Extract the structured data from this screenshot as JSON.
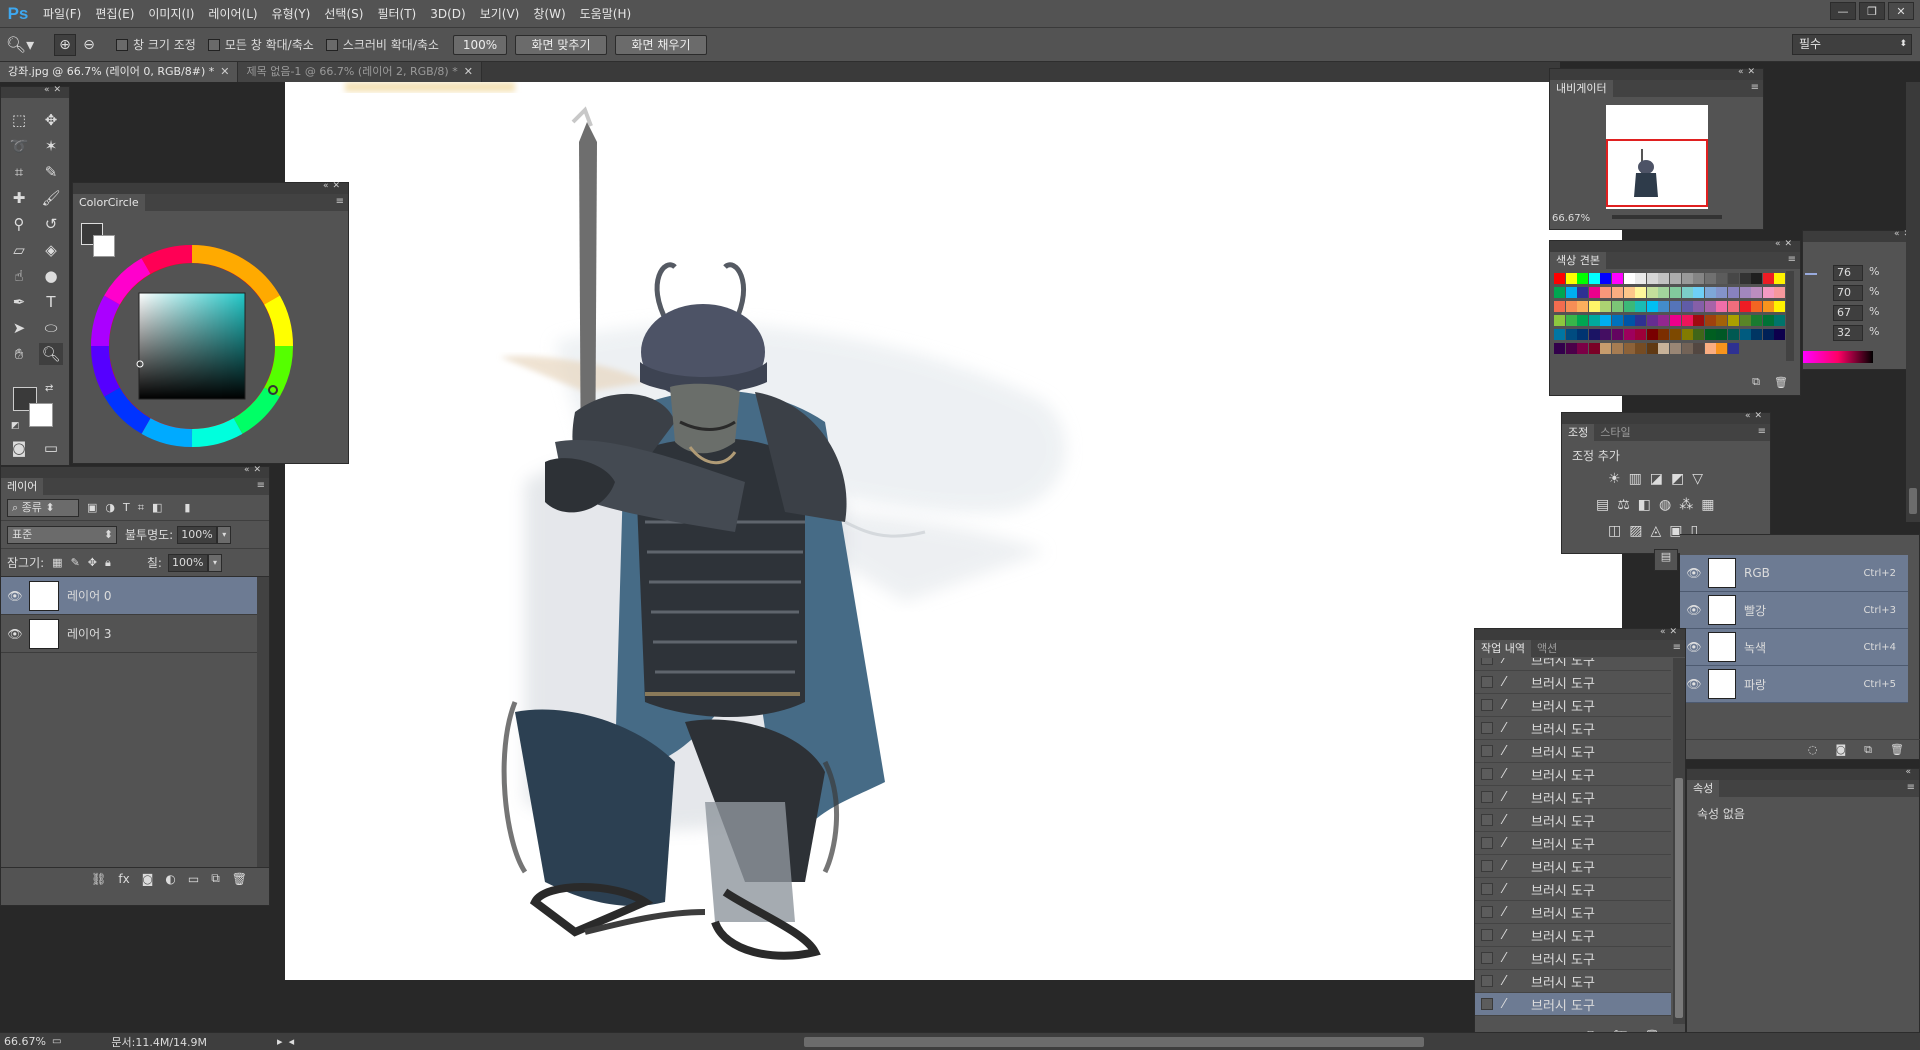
{
  "app": {
    "logo": "Ps"
  },
  "menu": [
    "파일(F)",
    "편집(E)",
    "이미지(I)",
    "레이어(L)",
    "유형(Y)",
    "선택(S)",
    "필터(T)",
    "3D(D)",
    "보기(V)",
    "창(W)",
    "도움말(H)"
  ],
  "window_controls": {
    "minimize": "—",
    "restore": "❐",
    "close": "✕"
  },
  "options": {
    "zoom_in": "⊕",
    "zoom_out": "⊖",
    "resize_window": "창 크기 조정",
    "zoom_all": "모든 창 확대/축소",
    "scrubby": "스크러비 확대/축소",
    "zoom_value": "100%",
    "fit_screen": "화면 맞추기",
    "fill_screen": "화면 채우기",
    "workspace": "필수"
  },
  "tabs": [
    {
      "label": "강좌.jpg @ 66.7% (레이어 0, RGB/8#) *",
      "active": true
    },
    {
      "label": "제목 없음-1 @ 66.7% (레이어 2, RGB/8) *",
      "active": false
    }
  ],
  "colorcircle": {
    "title": "ColorCircle"
  },
  "layers": {
    "tab": "레이어",
    "filter_kind": "종류",
    "blend_mode": "표준",
    "opacity_label": "불투명도:",
    "opacity_value": "100%",
    "lock_label": "잠그기:",
    "fill_label": "칠:",
    "fill_value": "100%",
    "items": [
      {
        "name": "레이어 0",
        "selected": true
      },
      {
        "name": "레이어 3",
        "selected": false
      }
    ],
    "footer_icons": [
      "link-icon",
      "fx-icon",
      "mask-icon",
      "adjustment-icon",
      "folder-icon",
      "new-layer-icon",
      "trash-icon"
    ]
  },
  "navigator": {
    "tab": "내비게이터",
    "zoom": "66.67%"
  },
  "swatches": {
    "tab": "색상 견본"
  },
  "color_values": [
    "76",
    "70",
    "67",
    "32"
  ],
  "color_unit": "%",
  "adjustments": {
    "tabs": [
      "조정",
      "스타일"
    ],
    "add_label": "조정 추가"
  },
  "history": {
    "tabs": [
      "작업 내역",
      "액션"
    ],
    "items": [
      "브러시 도구",
      "브러시 도구",
      "브러시 도구",
      "브러시 도구",
      "브러시 도구",
      "브러시 도구",
      "브러시 도구",
      "브러시 도구",
      "브러시 도구",
      "브러시 도구",
      "브러시 도구",
      "브러시 도구",
      "브러시 도구",
      "브러시 도구",
      "브러시 도구",
      "브러시 도구"
    ]
  },
  "channels": [
    {
      "name": "RGB",
      "shortcut": "Ctrl+2"
    },
    {
      "name": "빨강",
      "shortcut": "Ctrl+3"
    },
    {
      "name": "녹색",
      "shortcut": "Ctrl+4"
    },
    {
      "name": "파랑",
      "shortcut": "Ctrl+5"
    }
  ],
  "properties": {
    "tab": "속성",
    "empty": "속성 없음"
  },
  "status": {
    "zoom": "66.67%",
    "doc": "문서:11.4M/14.9M"
  }
}
